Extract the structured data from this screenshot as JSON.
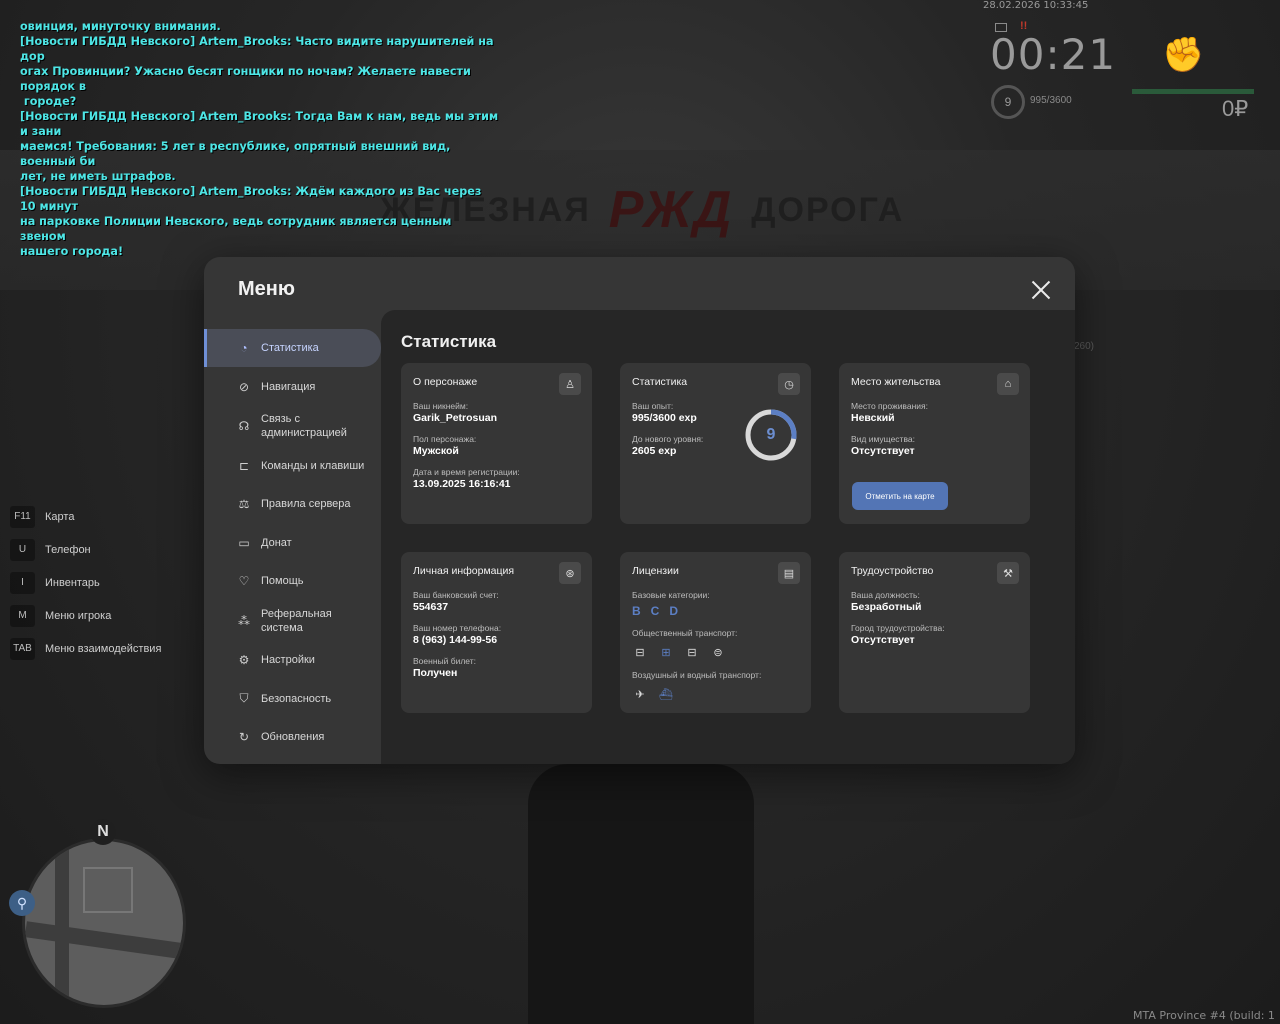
{
  "chat": [
    "овинция, минуточку внимания.",
    "[Новости ГИБДД Невского] Artem_Brooks: Часто видите нарушителей на дор\nогах Провинции? Ужасно бесят гонщики по ночам? Желаете навести порядок в\n городе?",
    "[Новости ГИБДД Невского] Artem_Brooks: Тогда Вам к нам, ведь мы этим и зани\nмаемся! Требования: 5 лет в республике, опрятный внешний вид, военный би\nлет, не иметь штрафов.",
    "[Новости ГИБДД Невского] Artem_Brooks: Ждём каждого из Вас через 10 минут\nна парковке Полиции Невского, ведь сотрудник является ценным звеном\nнашего города!"
  ],
  "background": {
    "sign_left": "ЖЕЛЕЗНАЯ",
    "sign_logo": "РЖД",
    "sign_right": "ДОРОГА"
  },
  "hud": {
    "datetime": "28.02.2026 10:33:45",
    "time": "00:21",
    "level": "9",
    "exp": "995/3600",
    "money": "0₽",
    "fist_icon": "fist-icon",
    "mail_icon": "mail-icon"
  },
  "keys": [
    {
      "key": "F11",
      "label": "Карта"
    },
    {
      "key": "U",
      "label": "Телефон"
    },
    {
      "key": "I",
      "label": "Инвентарь"
    },
    {
      "key": "M",
      "label": "Меню игрока"
    },
    {
      "key": "TAB",
      "label": "Меню взаимодействия"
    }
  ],
  "minimap": {
    "north": "N"
  },
  "build_info": "MTA Province #4 (build: 1",
  "build_info_side": "260)",
  "menu": {
    "title": "Меню",
    "nav": [
      {
        "label": "Статистика",
        "icon": "pie-chart-icon",
        "active": true
      },
      {
        "label": "Навигация",
        "icon": "compass-icon"
      },
      {
        "label": "Связь с\nадминистрацией",
        "icon": "headset-icon"
      },
      {
        "label": "Команды и клавиши",
        "icon": "keyboard-icon"
      },
      {
        "label": "Правила сервера",
        "icon": "scales-icon"
      },
      {
        "label": "Донат",
        "icon": "wallet-icon"
      },
      {
        "label": "Помощь",
        "icon": "handshake-icon"
      },
      {
        "label": "Реферальная\nсистема",
        "icon": "network-icon"
      },
      {
        "label": "Настройки",
        "icon": "gear-icon"
      },
      {
        "label": "Безопасность",
        "icon": "shield-icon"
      },
      {
        "label": "Обновления",
        "icon": "refresh-check-icon"
      }
    ],
    "content_title": "Статистика",
    "cards": {
      "character": {
        "title": "О персонаже",
        "nick_label": "Ваш никнейм:",
        "nick": "Garik_Petrosuan",
        "gender_label": "Пол персонажа:",
        "gender": "Мужской",
        "reg_label": "Дата и время регистрации:",
        "reg": "13.09.2025 16:16:41"
      },
      "stats": {
        "title": "Статистика",
        "exp_label": "Ваш опыт:",
        "exp": "995/3600 exp",
        "next_label": "До нового уровня:",
        "next": "2605 exp",
        "level": "9",
        "progress": 0.276
      },
      "residence": {
        "title": "Место жительства",
        "place_label": "Место проживания:",
        "place": "Невский",
        "property_label": "Вид имущества:",
        "property": "Отсутствует",
        "button": "Отметить на карте"
      },
      "personal": {
        "title": "Личная информация",
        "bank_label": "Ваш банковский счет:",
        "bank": "554637",
        "phone_label": "Ваш номер телефона:",
        "phone": "8 (963) 144-99-56",
        "military_label": "Военный билет:",
        "military": "Получен"
      },
      "licenses": {
        "title": "Лицензии",
        "base_label": "Базовые категории:",
        "base": [
          "B",
          "C",
          "D"
        ],
        "public_label": "Общественный транспорт:",
        "air_label": "Воздушный и водный транспорт:"
      },
      "job": {
        "title": "Трудоустройство",
        "position_label": "Ваша должность:",
        "position": "Безработный",
        "city_label": "Город трудоустройства:",
        "city": "Отсутствует"
      }
    }
  },
  "colors": {
    "accent": "#5375b5",
    "chat": "#4ee6e6",
    "modal_bg": "#363636",
    "content_bg": "#262626"
  }
}
